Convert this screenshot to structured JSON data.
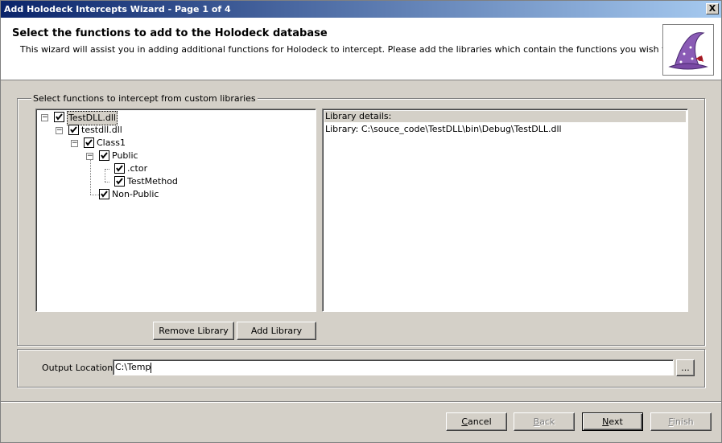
{
  "window": {
    "title": "Add Holodeck Intercepts Wizard - Page 1 of 4",
    "close_label": "X"
  },
  "header": {
    "title": "Select the functions to add to the Holodeck database",
    "description": "This wizard will assist you in adding additional functions for Holodeck to intercept. Please add the libraries which contain the functions you wish to add."
  },
  "group": {
    "legend": "Select functions to intercept from custom libraries"
  },
  "tree": {
    "items": [
      {
        "label": "TestDLL.dll",
        "checked": true,
        "expanded": true,
        "selected": true
      },
      {
        "label": "testdll.dll",
        "checked": true,
        "expanded": true
      },
      {
        "label": "Class1",
        "checked": true,
        "expanded": true
      },
      {
        "label": "Public",
        "checked": true,
        "expanded": true
      },
      {
        "label": ".ctor",
        "checked": true
      },
      {
        "label": "TestMethod",
        "checked": true
      },
      {
        "label": "Non-Public",
        "checked": true
      }
    ]
  },
  "details": {
    "header": "Library details:",
    "library_line": "Library: C:\\souce_code\\TestDLL\\bin\\Debug\\TestDLL.dll"
  },
  "buttons": {
    "remove_library": "Remove Library",
    "add_library": "Add Library",
    "browse": "...",
    "cancel": "Cancel",
    "back": "Back",
    "next": "Next",
    "finish": "Finish"
  },
  "output": {
    "label": "Output Location",
    "value": "C:\\Temp"
  },
  "icons": {
    "wizard": "wizard-hat-icon",
    "checkbox": "checkmark-icon",
    "expander": "minus-expander-icon"
  }
}
